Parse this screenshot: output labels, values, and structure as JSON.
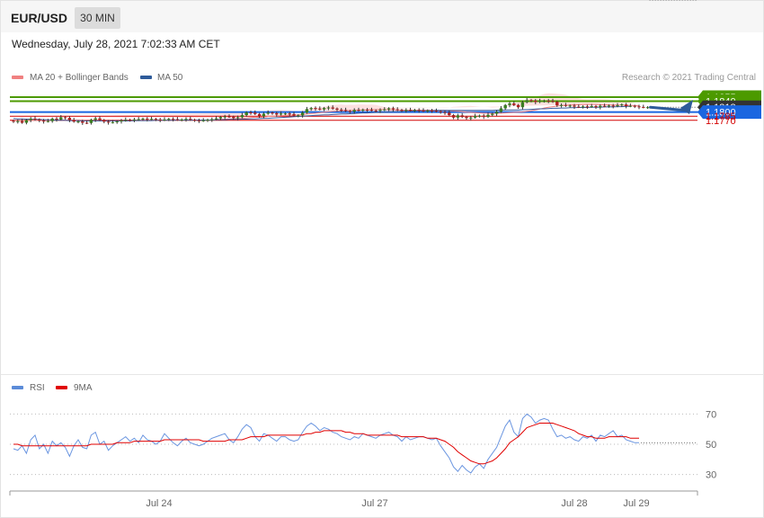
{
  "header": {
    "symbol": "EUR/USD",
    "timeframe": "30 MIN",
    "timestamp": "Wednesday, July 28, 2021 7:02:33 AM CET"
  },
  "legend": {
    "ma20": "MA 20 + Bollinger Bands",
    "ma50": "MA 50",
    "credit": "Research © 2021 Trading Central",
    "rsi": "RSI",
    "ma9": "9MA"
  },
  "colors": {
    "green": "#4c9a00",
    "blue": "#1a66e0",
    "red": "#d40000",
    "dark": "#333333",
    "bull": "#3a7d22",
    "bear": "#b02020",
    "band": "#fde0e0",
    "ma20": "#f08080",
    "ma50": "#3a5a9c",
    "arrow": "#2e5b9a"
  },
  "chart_data": [
    {
      "type": "candlestick",
      "title": "",
      "ylim": [
        1.1704,
        1.1863
      ],
      "x_labels": [
        "Jul 24",
        "Jul 27",
        "Jul 28",
        "Jul 29"
      ],
      "levels": [
        {
          "value": 1.1855,
          "label": "1.1855",
          "kind": "resistance",
          "color": "green"
        },
        {
          "value": 1.184,
          "label": "1.1840",
          "kind": "resistance",
          "color": "green"
        },
        {
          "value": 1.1818,
          "label": "1.1818",
          "kind": "last",
          "color": "dark"
        },
        {
          "value": 1.18,
          "label": "1.1800",
          "kind": "pivot",
          "color": "blue"
        },
        {
          "value": 1.1785,
          "label": "1.1785",
          "kind": "support",
          "color": "red"
        },
        {
          "value": 1.177,
          "label": "1.1770",
          "kind": "support",
          "color": "red"
        }
      ],
      "close": [
        1.1766,
        1.1767,
        1.1761,
        1.1771,
        1.1776,
        1.1773,
        1.1769,
        1.1766,
        1.1767,
        1.1776,
        1.1773,
        1.1781,
        1.1779,
        1.1771,
        1.1765,
        1.1766,
        1.1761,
        1.176,
        1.1772,
        1.1777,
        1.1771,
        1.1765,
        1.1762,
        1.1763,
        1.1766,
        1.1769,
        1.1772,
        1.1771,
        1.1773,
        1.1774,
        1.1776,
        1.1774,
        1.1775,
        1.1773,
        1.1771,
        1.1773,
        1.1775,
        1.1774,
        1.1772,
        1.1773,
        1.1775,
        1.1772,
        1.177,
        1.1768,
        1.177,
        1.1772,
        1.1774,
        1.1777,
        1.1782,
        1.1784,
        1.1783,
        1.1778,
        1.1781,
        1.1789,
        1.1799,
        1.1798,
        1.1793,
        1.1785,
        1.1794,
        1.1798,
        1.1796,
        1.1791,
        1.1795,
        1.1795,
        1.1793,
        1.1787,
        1.1788,
        1.1798,
        1.1811,
        1.1815,
        1.1813,
        1.181,
        1.1815,
        1.1817,
        1.1813,
        1.1809,
        1.1808,
        1.1804,
        1.1802,
        1.1808,
        1.1806,
        1.1809,
        1.1808,
        1.1806,
        1.1805,
        1.1808,
        1.181,
        1.1814,
        1.181,
        1.1808,
        1.1806,
        1.1808,
        1.1806,
        1.1808,
        1.1806,
        1.1804,
        1.1806,
        1.1805,
        1.1803,
        1.18,
        1.1798,
        1.1789,
        1.178,
        1.1788,
        1.1782,
        1.1778,
        1.178,
        1.1786,
        1.1787,
        1.1783,
        1.179,
        1.1794,
        1.1801,
        1.1814,
        1.1826,
        1.1832,
        1.1826,
        1.1818,
        1.1836,
        1.1844,
        1.1842,
        1.1837,
        1.1841,
        1.1842,
        1.1841,
        1.1838,
        1.1825,
        1.1826,
        1.1823,
        1.1824,
        1.182,
        1.1819,
        1.1821,
        1.182,
        1.1822,
        1.1818,
        1.1823,
        1.1822,
        1.1824,
        1.1822,
        1.1825,
        1.1828,
        1.1822,
        1.1823,
        1.1821,
        1.1819,
        1.1818,
        1.1818
      ],
      "ma20": [
        1.177,
        1.177,
        1.177,
        1.177,
        1.177,
        1.177,
        1.177,
        1.177,
        1.1771,
        1.1771,
        1.1771,
        1.1771,
        1.1771,
        1.1771,
        1.1771,
        1.177,
        1.177,
        1.1769,
        1.1769,
        1.1769,
        1.1769,
        1.1768,
        1.1768,
        1.1768,
        1.1768,
        1.1768,
        1.1768,
        1.1768,
        1.1769,
        1.1769,
        1.177,
        1.177,
        1.1771,
        1.1771,
        1.1771,
        1.1771,
        1.1771,
        1.1771,
        1.1771,
        1.1771,
        1.1771,
        1.1771,
        1.1771,
        1.1771,
        1.1771,
        1.1771,
        1.1771,
        1.1772,
        1.1773,
        1.1774,
        1.1775,
        1.1775,
        1.1776,
        1.1777,
        1.1778,
        1.178,
        1.1781,
        1.1781,
        1.1782,
        1.1784,
        1.1785,
        1.1786,
        1.1787,
        1.1788,
        1.1789,
        1.1789,
        1.179,
        1.1791,
        1.1793,
        1.1795,
        1.1796,
        1.1798,
        1.18,
        1.1802,
        1.1803,
        1.1804,
        1.1805,
        1.1805,
        1.1806,
        1.1806,
        1.1807,
        1.1808,
        1.1808,
        1.1809,
        1.1809,
        1.1809,
        1.1809,
        1.1808,
        1.1808,
        1.1808,
        1.1807,
        1.1807,
        1.1807,
        1.1807,
        1.1807,
        1.1807,
        1.1807,
        1.1807,
        1.1806,
        1.1806,
        1.1806,
        1.1805,
        1.1804,
        1.1803,
        1.1802,
        1.18,
        1.1799,
        1.1798,
        1.1797,
        1.1796,
        1.1796,
        1.1795,
        1.1796,
        1.1796,
        1.1797,
        1.1798,
        1.1799,
        1.18,
        1.1801,
        1.1803,
        1.1805,
        1.1808,
        1.1811,
        1.1815,
        1.1818,
        1.182,
        1.1822,
        1.1824,
        1.1825,
        1.1826,
        1.1827,
        1.1827,
        1.1828,
        1.1828,
        1.1828,
        1.1828,
        1.1827,
        1.1827,
        1.1827,
        1.1826,
        1.1826,
        1.1826,
        1.1825,
        1.1825,
        1.1824,
        1.1824
      ],
      "ma50": [
        1.1776,
        1.1775,
        1.1775,
        1.1774,
        1.1774,
        1.1773,
        1.1773,
        1.1772,
        1.1772,
        1.1771,
        1.1771,
        1.177,
        1.177,
        1.1769,
        1.1769,
        1.1769,
        1.1768,
        1.1768,
        1.1768,
        1.1768,
        1.1768,
        1.1768,
        1.1768,
        1.1768,
        1.1768,
        1.1768,
        1.1768,
        1.1768,
        1.1769,
        1.1769,
        1.1769,
        1.1769,
        1.1769,
        1.177,
        1.177,
        1.177,
        1.177,
        1.177,
        1.1771,
        1.1771,
        1.1771,
        1.1771,
        1.1771,
        1.1771,
        1.1771,
        1.1771,
        1.1771,
        1.1772,
        1.1772,
        1.1772,
        1.1773,
        1.1773,
        1.1773,
        1.1774,
        1.1774,
        1.1775,
        1.1775,
        1.1776,
        1.1777,
        1.1777,
        1.1778,
        1.1779,
        1.178,
        1.1781,
        1.1782,
        1.1783,
        1.1784,
        1.1785,
        1.1786,
        1.1787,
        1.1788,
        1.1789,
        1.179,
        1.179,
        1.1791,
        1.1792,
        1.1793,
        1.1793,
        1.1794,
        1.1795,
        1.1796,
        1.1797,
        1.1797,
        1.1798,
        1.1799,
        1.1799,
        1.18,
        1.1801,
        1.1802,
        1.1802,
        1.1803,
        1.1803,
        1.1804,
        1.1804,
        1.1805,
        1.1805,
        1.1805,
        1.1805,
        1.1806,
        1.1806,
        1.1806,
        1.1806,
        1.1806,
        1.1806,
        1.1806,
        1.1806,
        1.1806,
        1.1806,
        1.1806,
        1.1806,
        1.1806,
        1.1806,
        1.1807,
        1.1807,
        1.1808,
        1.1808,
        1.1808,
        1.1808,
        1.1809,
        1.1809,
        1.181,
        1.1811,
        1.1812,
        1.1812,
        1.1813,
        1.1814,
        1.1814,
        1.1815,
        1.1815,
        1.1816,
        1.1816,
        1.1817,
        1.1817,
        1.1817,
        1.1818,
        1.1818,
        1.1818,
        1.1819,
        1.1819,
        1.1819,
        1.182,
        1.182,
        1.1821,
        1.1821
      ],
      "forecast": {
        "from": 1.1818,
        "to": 1.1855
      }
    },
    {
      "type": "line",
      "title": "",
      "series": [
        {
          "name": "RSI"
        },
        {
          "name": "9MA"
        }
      ],
      "ylim": [
        20,
        80
      ],
      "y_ticks": [
        "70",
        "50",
        "30"
      ],
      "rsi": [
        47,
        46,
        49,
        44,
        53,
        56,
        47,
        50,
        44,
        52,
        49,
        51,
        48,
        42,
        49,
        53,
        48,
        47,
        56,
        58,
        50,
        52,
        46,
        49,
        51,
        53,
        55,
        52,
        54,
        51,
        56,
        53,
        52,
        50,
        52,
        57,
        54,
        51,
        49,
        52,
        54,
        51,
        50,
        49,
        50,
        52,
        54,
        55,
        56,
        57,
        53,
        51,
        55,
        60,
        63,
        61,
        55,
        52,
        57,
        56,
        54,
        52,
        55,
        55,
        53,
        52,
        53,
        58,
        62,
        64,
        62,
        59,
        61,
        60,
        58,
        57,
        55,
        54,
        53,
        55,
        54,
        57,
        56,
        55,
        54,
        56,
        57,
        58,
        56,
        55,
        52,
        55,
        53,
        54,
        55,
        55,
        54,
        53,
        54,
        49,
        45,
        41,
        35,
        32,
        36,
        33,
        31,
        35,
        37,
        34,
        40,
        44,
        48,
        55,
        62,
        66,
        58,
        55,
        67,
        70,
        68,
        64,
        66,
        67,
        66,
        60,
        55,
        56,
        54,
        55,
        53,
        52,
        55,
        54,
        56,
        52,
        56,
        55,
        57,
        59,
        55,
        56,
        53,
        52,
        51,
        51
      ],
      "ma9": [
        50,
        50,
        49,
        49,
        49,
        49,
        49,
        49,
        49,
        49,
        49,
        49,
        49,
        49,
        49,
        49,
        49,
        49,
        50,
        50,
        50,
        50,
        50,
        50,
        51,
        51,
        51,
        51,
        52,
        52,
        52,
        52,
        52,
        52,
        52,
        53,
        53,
        53,
        53,
        53,
        53,
        53,
        53,
        53,
        52,
        52,
        52,
        52,
        52,
        52,
        53,
        53,
        53,
        53,
        54,
        55,
        55,
        55,
        55,
        56,
        56,
        56,
        56,
        56,
        56,
        56,
        56,
        56,
        57,
        57,
        58,
        58,
        59,
        59,
        59,
        59,
        59,
        58,
        58,
        57,
        57,
        57,
        56,
        56,
        56,
        56,
        56,
        56,
        56,
        56,
        55,
        55,
        55,
        55,
        55,
        55,
        54,
        54,
        54,
        53,
        52,
        50,
        48,
        45,
        43,
        41,
        39,
        38,
        37,
        37,
        38,
        39,
        41,
        44,
        47,
        51,
        53,
        55,
        58,
        61,
        62,
        63,
        64,
        64,
        64,
        64,
        63,
        62,
        61,
        60,
        59,
        57,
        56,
        55,
        55,
        54,
        54,
        54,
        55,
        55,
        55,
        55,
        55,
        54,
        54,
        54
      ],
      "last": 51
    }
  ]
}
